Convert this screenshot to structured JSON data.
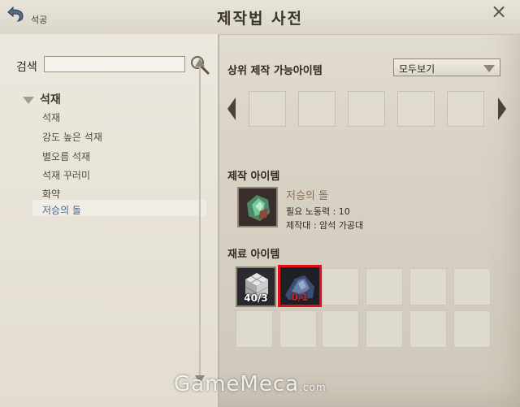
{
  "window": {
    "title": "제작법 사전",
    "back_label": "석공",
    "close_label": "×"
  },
  "search": {
    "label": "검색",
    "value": "",
    "placeholder": ""
  },
  "category": {
    "label": "석재",
    "items": [
      {
        "label": "석재",
        "selected": false
      },
      {
        "label": "강도 높은 석재",
        "selected": false
      },
      {
        "label": "별오름 석재",
        "selected": false
      },
      {
        "label": "석재 꾸러미",
        "selected": false
      },
      {
        "label": "화약",
        "selected": false
      },
      {
        "label": "저승의 돌",
        "selected": true
      }
    ]
  },
  "upper": {
    "label": "상위 제작 가능아이템",
    "filter_value": "모두보기"
  },
  "product": {
    "section_label": "제작 아이템",
    "name": "저승의 돌",
    "labor": "필요 노동력 : 10",
    "workbench": "제작대 : 암석 가공대",
    "icon": "green-stone-icon"
  },
  "materials": {
    "section_label": "재료 아이템",
    "items": [
      {
        "icon": "stone-block-icon",
        "count": "40/3"
      },
      {
        "icon": "dark-ore-icon",
        "count": "0/1"
      }
    ]
  },
  "watermark": {
    "text": "GameMeca",
    "suffix": ".com"
  },
  "colors": {
    "selected_border": "#e0101a",
    "selected_item_text": "#4a6688",
    "product_name": "#8a6d55"
  }
}
